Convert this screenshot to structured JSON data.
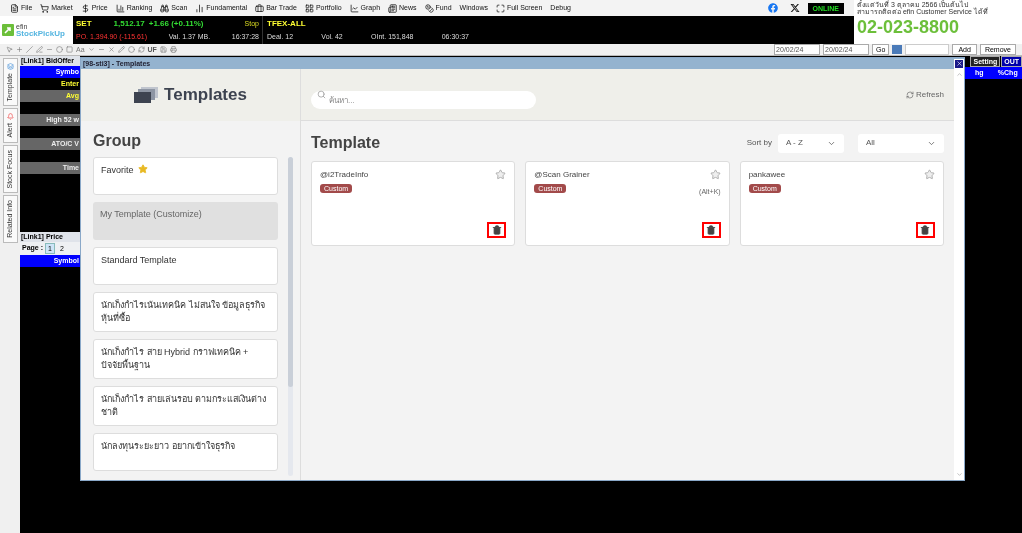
{
  "menu": [
    "File",
    "Market",
    "Price",
    "Ranking",
    "Scan",
    "Fundamental",
    "Bar Trade",
    "Portfolio",
    "Graph",
    "News",
    "Fund",
    "Windows",
    "Full Screen",
    "Debug"
  ],
  "status": "ONLINE",
  "banner": {
    "line1": "ตั้งแต่วันที่ 3 ตุลาคม 2566 เป็นต้นไป",
    "line2": "สามารถติดต่อ efin Customer Service ได้ที่",
    "phone": "02-023-8800"
  },
  "logo": {
    "top": "efin",
    "bottom": "StockPickUp"
  },
  "ticker": {
    "index": "SET",
    "value": "1,512.17",
    "change": "+1.66 (+0.11%)",
    "state": "Stop",
    "market": "TFEX-ALL",
    "po": "PO. 1,394.90 (-115.61)",
    "traded": "Val. 1.37 MB.",
    "time1": "16:37:28",
    "deal": "Deal. 12",
    "volume": "Vol. 42",
    "open_interest": "OInt. 151,848",
    "time2": "06:30:37"
  },
  "toolbar": {
    "labels": [
      "Aa",
      "UF"
    ],
    "date_from": "20/02/24",
    "date_to": "20/02/24",
    "go": "Go",
    "add": "Add",
    "remove": "Remove"
  },
  "side_tabs": [
    "Template",
    "Alert",
    "Stock Focus",
    "Related Info"
  ],
  "bidoffer": {
    "title": "[Link1] BidOffer",
    "rows": [
      {
        "label": "Symbo",
        "kind": "header"
      },
      {
        "label": "Enter",
        "kind": "plain"
      },
      {
        "label": "Avg",
        "kind": "gray"
      },
      {
        "label": "High 52 w",
        "kind": "gray"
      },
      {
        "label": "ATO/C V",
        "kind": "gray"
      },
      {
        "label": "Time",
        "kind": "gray"
      }
    ]
  },
  "price": {
    "title": "[Link1] Price",
    "page_label": "Page :",
    "pages": [
      {
        "label": "1",
        "selected": true
      },
      {
        "label": "2",
        "selected": false
      }
    ],
    "header": "Symbol"
  },
  "right_panel": {
    "setting": "Setting",
    "out": "OUT",
    "columns": [
      "hg",
      "%Chg"
    ]
  },
  "dialog": {
    "title": "[98-sti3] - Templates",
    "heading": "Templates",
    "search_placeholder": "ค้นหา...",
    "refresh": "Refresh",
    "group_title": "Group",
    "groups": [
      {
        "label": "Favorite",
        "kind": "favorite",
        "selected": false
      },
      {
        "label": "My Template (Customize)",
        "kind": "plain",
        "selected": true
      },
      {
        "label": "Standard Template",
        "kind": "plain",
        "selected": false
      },
      {
        "label": "นักเก็งกำไรเน้นเทคนิค ไม่สนใจ ข้อมูลธุรกิจหุ้นที่ซื้อ",
        "kind": "plain",
        "selected": false
      },
      {
        "label": "นักเก็งกำไร สาย Hybrid กราฟเทคนิค + ปัจจัยพื้นฐาน",
        "kind": "plain",
        "selected": false
      },
      {
        "label": "นักเก็งกำไร สายเล่นรอบ ตามกระแสเงินต่างชาติ",
        "kind": "plain",
        "selected": false
      },
      {
        "label": "นักลงทุนระยะยาว อยากเข้าใจธุรกิจ",
        "kind": "plain",
        "selected": false
      }
    ],
    "template_title": "Template",
    "sort_label": "Sort by",
    "sort_value": "A - Z",
    "filter_value": "All",
    "templates": [
      {
        "name": "@i2TradeInfo",
        "tag": "Custom",
        "starred": false
      },
      {
        "name": "@Scan Grainer",
        "tag": "Custom",
        "shortcut": "(Alt+K)",
        "starred": false
      },
      {
        "name": "pankawee",
        "tag": "Custom",
        "starred": false
      }
    ]
  }
}
